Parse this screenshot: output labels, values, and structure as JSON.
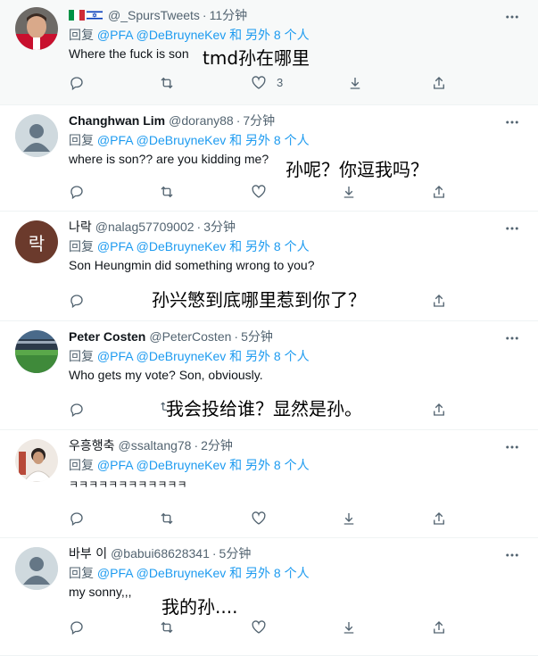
{
  "tweets": [
    {
      "name": "",
      "handle": "@_SpursTweets",
      "time": "11分钟",
      "reply_prefix": "回复",
      "reply_mentions": "@PFA @DeBruyneKev",
      "reply_suffix": "和 另外 8 个人",
      "text": "Where the fuck is son",
      "translation": "tmd孙在哪里",
      "like_count": "3",
      "avatar": "photo-red-jersey",
      "flags": [
        "italy-flag",
        "israel-flag"
      ]
    },
    {
      "name": "Changhwan Lim",
      "handle": "@dorany88",
      "time": "7分钟",
      "reply_prefix": "回复",
      "reply_mentions": "@PFA @DeBruyneKev",
      "reply_suffix": "和 另外 8 个人",
      "text": "where is son?? are you kidding me?",
      "translation": "孙呢？你逗我吗？",
      "avatar": "default"
    },
    {
      "name": "나락",
      "handle": "@nalag57709002",
      "time": "3分钟",
      "reply_prefix": "回复",
      "reply_mentions": "@PFA @DeBruyneKev",
      "reply_suffix": "和 另外 8 个人",
      "text": "Son Heungmin did something wrong to you?",
      "translation": "孙兴慜到底哪里惹到你了？",
      "avatar_letter": "락",
      "avatar": "letter"
    },
    {
      "name": "Peter Costen",
      "handle": "@PeterCosten",
      "time": "5分钟",
      "reply_prefix": "回复",
      "reply_mentions": "@PFA @DeBruyneKev",
      "reply_suffix": "和 另外 8 个人",
      "text": "Who gets my vote? Son, obviously.",
      "translation": "我会投给谁？显然是孙。",
      "avatar": "stadium"
    },
    {
      "name": "우흥행축",
      "handle": "@ssaltang78",
      "time": "2分钟",
      "reply_prefix": "回复",
      "reply_mentions": "@PFA @DeBruyneKev",
      "reply_suffix": "和 另外 8 个人",
      "text": "ㅋㅋㅋㅋㅋㅋㅋㅋㅋㅋㅋㅋ",
      "translation": "",
      "avatar": "photo-person"
    },
    {
      "name": "바부 이",
      "handle": "@babui68628341",
      "time": "5分钟",
      "reply_prefix": "回复",
      "reply_mentions": "@PFA @DeBruyneKev",
      "reply_suffix": "和 另外 8 个人",
      "text": "my sonny,,,",
      "translation": "我的孙....",
      "avatar": "default"
    }
  ],
  "colors": {
    "accent": "#1d9bf0",
    "muted": "#536471",
    "highlight_bg": "#f7f9f9"
  }
}
